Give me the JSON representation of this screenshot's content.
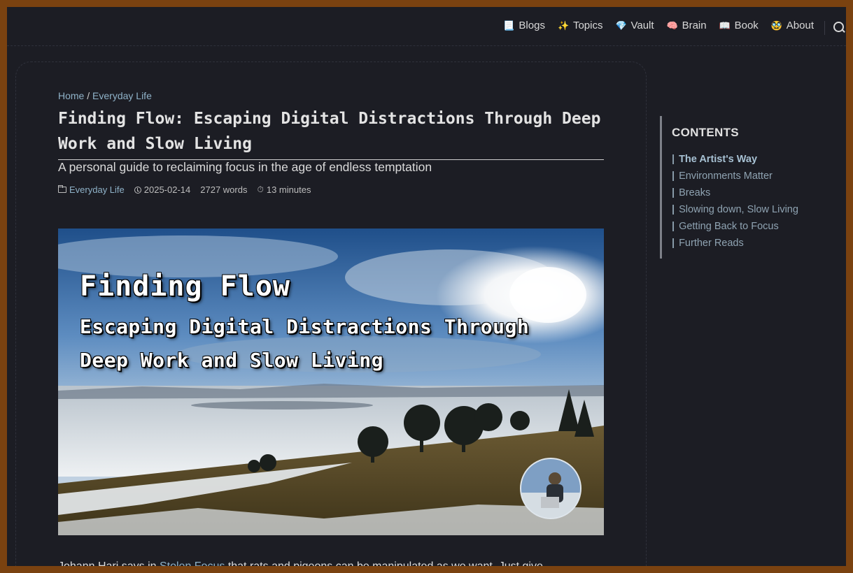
{
  "nav": {
    "items": [
      {
        "icon": "📃",
        "label": "Blogs"
      },
      {
        "icon": "✨",
        "label": "Topics"
      },
      {
        "icon": "💎",
        "label": "Vault"
      },
      {
        "icon": "🧠",
        "label": "Brain"
      },
      {
        "icon": "📖",
        "label": "Book"
      },
      {
        "icon": "🥸",
        "label": "About"
      }
    ]
  },
  "breadcrumb": {
    "home": "Home",
    "separator": "/",
    "current": "Everyday Life"
  },
  "article": {
    "title": "Finding Flow: Escaping Digital Distractions Through Deep Work and Slow Living",
    "subtitle": "A personal guide to reclaiming focus in the age of endless temptation",
    "meta": {
      "category": "Everyday Life",
      "date": "2025-02-14",
      "words": "2727 words",
      "reading_time": "13 minutes"
    },
    "hero": {
      "line1": "Finding Flow",
      "line2": "Escaping Digital Distractions Through",
      "line3": "Deep Work and Slow Living"
    },
    "body_start": "Johann Hari says in",
    "body_link": "Stolen Focus",
    "body_rest": "that rats and pigeons can be manipulated as we want. Just give"
  },
  "toc": {
    "title": "CONTENTS",
    "items": [
      "The Artist's Way",
      "Environments Matter",
      "Breaks",
      "Slowing down, Slow Living",
      "Getting Back to Focus",
      "Further Reads"
    ],
    "active_index": 0
  },
  "colors": {
    "background": "#1c1d24",
    "frame": "#7a4210",
    "link": "#8fb2c8"
  }
}
